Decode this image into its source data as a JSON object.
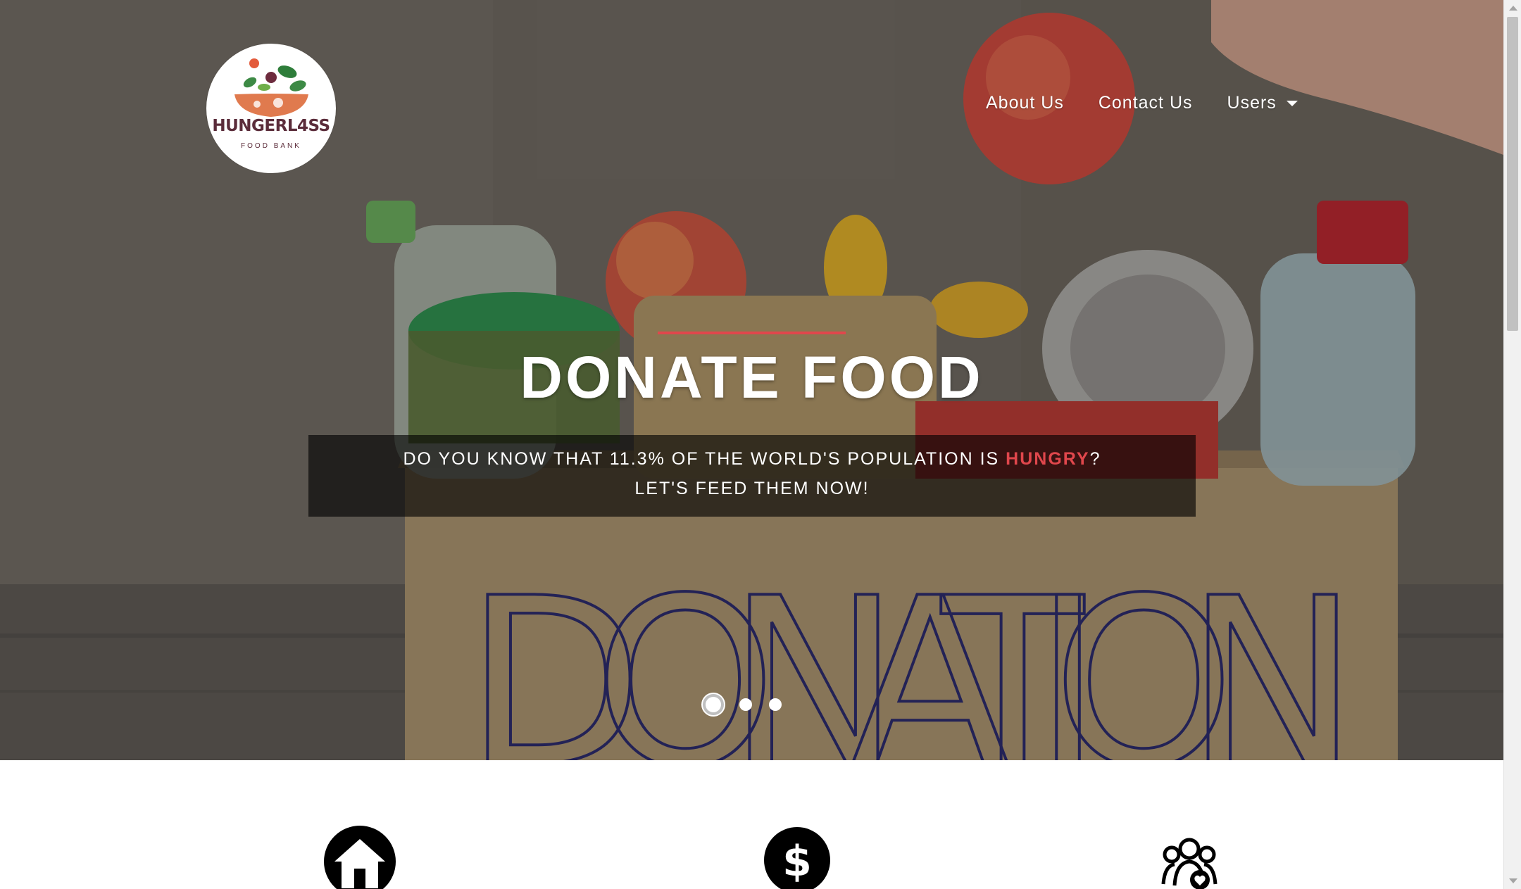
{
  "brand": {
    "name": "HUNGERL4SS",
    "tagline": "FOOD BANK"
  },
  "nav": {
    "items": [
      {
        "label": "About Us"
      },
      {
        "label": "Contact Us"
      },
      {
        "label": "Users"
      }
    ]
  },
  "hero": {
    "heading": "DONATE FOOD",
    "line1_before": "DO YOU KNOW THAT 11.3% OF THE WORLD'S POPULATION IS ",
    "line1_highlight": "HUNGRY",
    "line1_after": "?",
    "line2": "LET'S FEED THEM NOW!",
    "box_text": "DONATION",
    "slide_count": 3,
    "active_slide": 1
  },
  "features": {
    "icons": [
      "home-icon",
      "dollar-icon",
      "community-heart-icon"
    ]
  },
  "colors": {
    "accent": "#e0474c",
    "nav_text": "#ffffff",
    "logo_text": "#5b2c3a"
  }
}
